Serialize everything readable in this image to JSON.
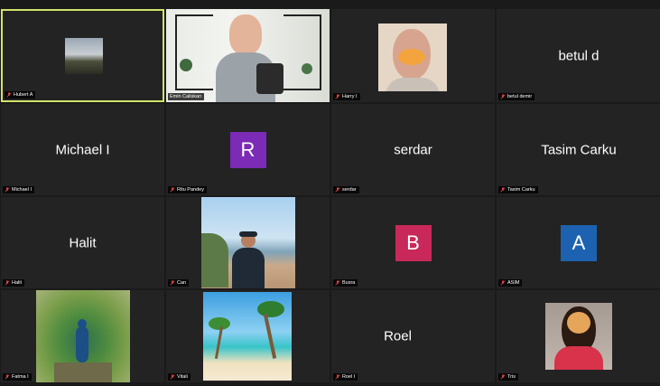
{
  "participants": [
    {
      "nametag": "Hubert A",
      "type": "video",
      "active": true
    },
    {
      "nametag": "Emin Caliskan",
      "type": "video"
    },
    {
      "nametag": "Harry I",
      "type": "video"
    },
    {
      "nametag": "betul demir",
      "center_name": "betul d",
      "type": "name"
    },
    {
      "nametag": "Michael I",
      "center_name": "Michael I",
      "type": "name"
    },
    {
      "nametag": "Ritu Pandey",
      "avatar_letter": "R",
      "avatar_color": "#7b2bb5",
      "type": "avatar"
    },
    {
      "nametag": "serdar",
      "center_name": "serdar",
      "type": "name"
    },
    {
      "nametag": "Tasim Carku",
      "center_name": "Tasim Carku",
      "type": "name"
    },
    {
      "nametag": "Halit",
      "center_name": "Halit",
      "type": "name"
    },
    {
      "nametag": "Can",
      "type": "video"
    },
    {
      "nametag": "Busra",
      "avatar_letter": "B",
      "avatar_color": "#c8285a",
      "type": "avatar"
    },
    {
      "nametag": "ASIM",
      "avatar_letter": "A",
      "avatar_color": "#1c62b0",
      "type": "avatar"
    },
    {
      "nametag": "Fatma I",
      "type": "video"
    },
    {
      "nametag": "Vitali",
      "type": "video"
    },
    {
      "nametag": "Roel I",
      "center_name": "Roel",
      "type": "name"
    },
    {
      "nametag": "Tris",
      "type": "video"
    }
  ],
  "colors": {
    "active_border": "#d3e26a",
    "mic_muted": "#e5484d",
    "tile_bg": "#232323"
  },
  "icons": {
    "nametag": "mic-muted-icon"
  }
}
